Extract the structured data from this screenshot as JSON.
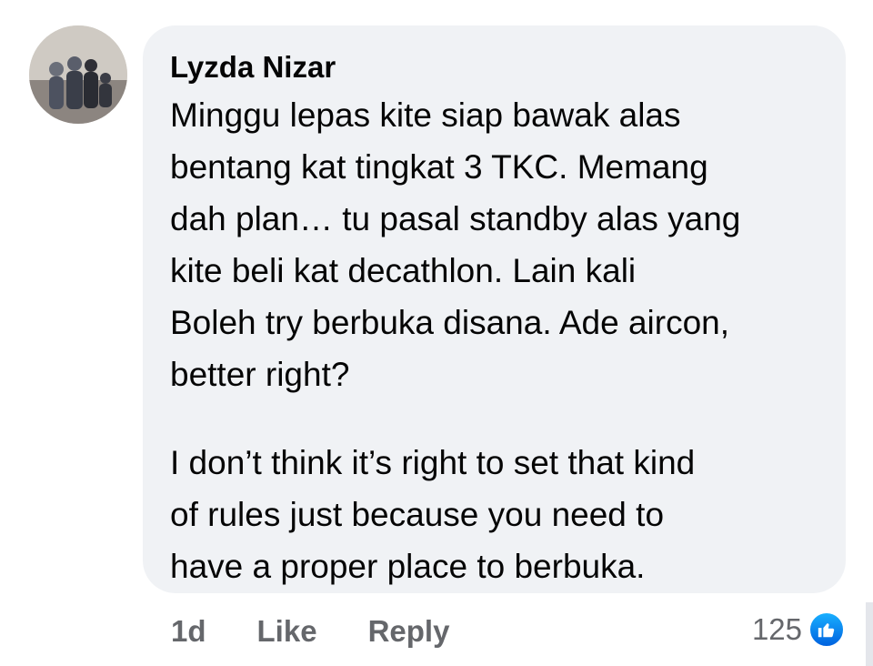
{
  "comment": {
    "author": "Lyzda Nizar",
    "body": [
      "Minggu lepas kite siap bawak alas\nbentang kat tingkat 3 TKC. Memang\ndah plan… tu pasal standby alas yang\nkite beli kat decathlon. Lain kali\nBoleh try berbuka disana. Ade aircon,\nbetter right?",
      "I don’t think it’s right to set that kind\nof rules just because you need to\nhave a proper place to berbuka."
    ],
    "timestamp": "1d",
    "like_label": "Like",
    "reply_label": "Reply",
    "reaction_count": "125",
    "reaction_icon": "thumbs-up-icon",
    "colors": {
      "bubble": "#f0f2f5",
      "meta_text": "#65676b",
      "like_blue": "#1877f2"
    }
  }
}
